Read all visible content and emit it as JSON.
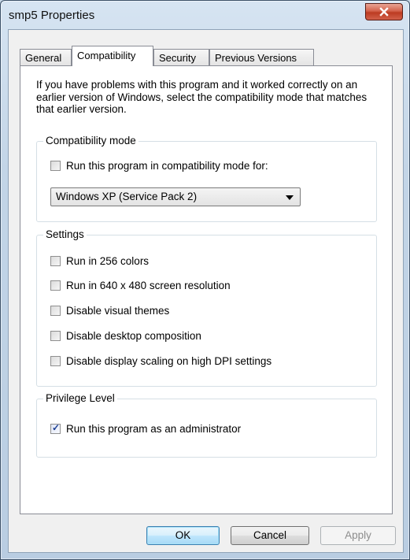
{
  "window": {
    "title": "smp5 Properties"
  },
  "tabs": [
    {
      "label": "General"
    },
    {
      "label": "Compatibility"
    },
    {
      "label": "Security"
    },
    {
      "label": "Previous Versions"
    }
  ],
  "intro": "If you have problems with this program and it worked correctly on an earlier version of Windows, select the compatibility mode that matches that earlier version.",
  "compat_mode": {
    "group_label": "Compatibility mode",
    "checkbox_label": "Run this program in compatibility mode for:",
    "checked": false,
    "selected_os": "Windows XP (Service Pack 2)"
  },
  "settings": {
    "group_label": "Settings",
    "items": [
      {
        "label": "Run in 256 colors",
        "checked": false
      },
      {
        "label": "Run in 640 x 480 screen resolution",
        "checked": false
      },
      {
        "label": "Disable visual themes",
        "checked": false
      },
      {
        "label": "Disable desktop composition",
        "checked": false
      },
      {
        "label": "Disable display scaling on high DPI settings",
        "checked": false
      }
    ]
  },
  "privilege": {
    "group_label": "Privilege Level",
    "checkbox_label": "Run this program as an administrator",
    "checked": true
  },
  "buttons": {
    "ok": "OK",
    "cancel": "Cancel",
    "apply": "Apply"
  }
}
